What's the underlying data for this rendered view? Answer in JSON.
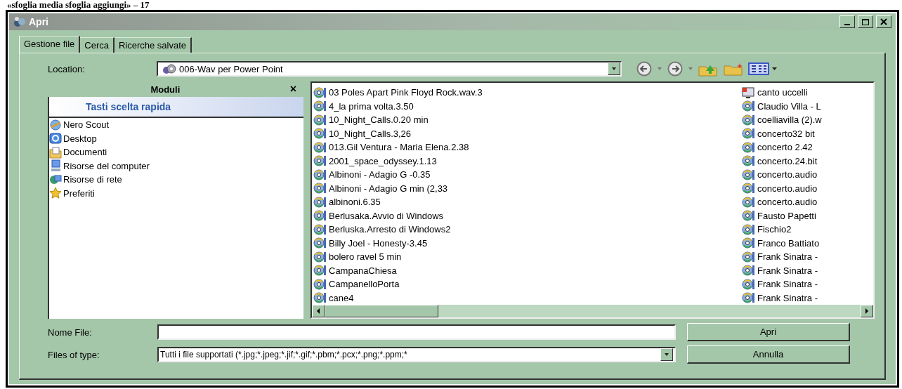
{
  "caption": "«sfoglia media sfoglia aggiungi» – 17",
  "window": {
    "title": "Apri"
  },
  "tabs": [
    {
      "label": "Gestione file",
      "selected": true
    },
    {
      "label": "Cerca",
      "selected": false
    },
    {
      "label": "Ricerche salvate",
      "selected": false
    }
  ],
  "location": {
    "label": "Location:",
    "value": "006-Wav per Power Point"
  },
  "sidebar": {
    "title": "Moduli",
    "close": "×",
    "section": "Tasti scelta rapida",
    "items": [
      {
        "label": "Nero Scout",
        "kind": "scout"
      },
      {
        "label": "Desktop",
        "kind": "desktop"
      },
      {
        "label": "Documenti",
        "kind": "documents"
      },
      {
        "label": "Risorse del computer",
        "kind": "computer"
      },
      {
        "label": "Risorse di rete",
        "kind": "network"
      },
      {
        "label": "Preferiti",
        "kind": "favorites"
      }
    ]
  },
  "files": [
    {
      "name": "03 Poles Apart Pink Floyd Rock.wav.3",
      "kind": "audio"
    },
    {
      "name": "4_la prima volta.3.50",
      "kind": "audio"
    },
    {
      "name": "10_Night_Calls.0.20 min",
      "kind": "audio"
    },
    {
      "name": "10_Night_Calls.3,26",
      "kind": "audio"
    },
    {
      "name": "013.Gil Ventura - Maria Elena.2.38",
      "kind": "audio"
    },
    {
      "name": "2001_space_odyssey.1.13",
      "kind": "audio"
    },
    {
      "name": "Albinoni - Adagio G -0.35",
      "kind": "audio"
    },
    {
      "name": "Albinoni - Adagio G min (2,33",
      "kind": "audio"
    },
    {
      "name": "albinoni.6.35",
      "kind": "audio"
    },
    {
      "name": "Berlusaka.Avvio di Windows",
      "kind": "audio"
    },
    {
      "name": "Berluska.Arresto di Windows2",
      "kind": "audio"
    },
    {
      "name": "Billy Joel - Honesty-3.45",
      "kind": "audio"
    },
    {
      "name": "bolero ravel 5 min",
      "kind": "audio"
    },
    {
      "name": "CampanaChiesa",
      "kind": "audio"
    },
    {
      "name": "CampanelloPorta",
      "kind": "audio"
    },
    {
      "name": "cane4",
      "kind": "audio"
    },
    {
      "name": "canto uccelli",
      "kind": "video"
    },
    {
      "name": "Claudio Villa - L",
      "kind": "audio"
    },
    {
      "name": "coelliavilla (2).w",
      "kind": "audio"
    },
    {
      "name": "concerto32 bit",
      "kind": "audio"
    },
    {
      "name": "concerto 2.42",
      "kind": "audio"
    },
    {
      "name": "concerto.24.bit",
      "kind": "audio"
    },
    {
      "name": "concerto.audio",
      "kind": "audio"
    },
    {
      "name": "concerto.audio",
      "kind": "audio"
    },
    {
      "name": "concerto.audio",
      "kind": "audio"
    },
    {
      "name": "Fausto Papetti",
      "kind": "audio"
    },
    {
      "name": "Fischio2",
      "kind": "audio"
    },
    {
      "name": "Franco Battiato",
      "kind": "audio"
    },
    {
      "name": "Frank Sinatra -",
      "kind": "audio"
    },
    {
      "name": "Frank Sinatra -",
      "kind": "audio"
    },
    {
      "name": "Frank Sinatra -",
      "kind": "audio"
    },
    {
      "name": "Frank Sinatra -",
      "kind": "audio"
    }
  ],
  "filename": {
    "label": "Nome File:"
  },
  "filetype": {
    "label": "Files of type:",
    "value": "Tutti i file supportati (*.jpg;*.jpeg;*.jif;*.gif;*.pbm;*.pcx;*.png;*.ppm;*"
  },
  "buttons": [
    {
      "label": "Apri"
    },
    {
      "label": "Annulla"
    }
  ]
}
